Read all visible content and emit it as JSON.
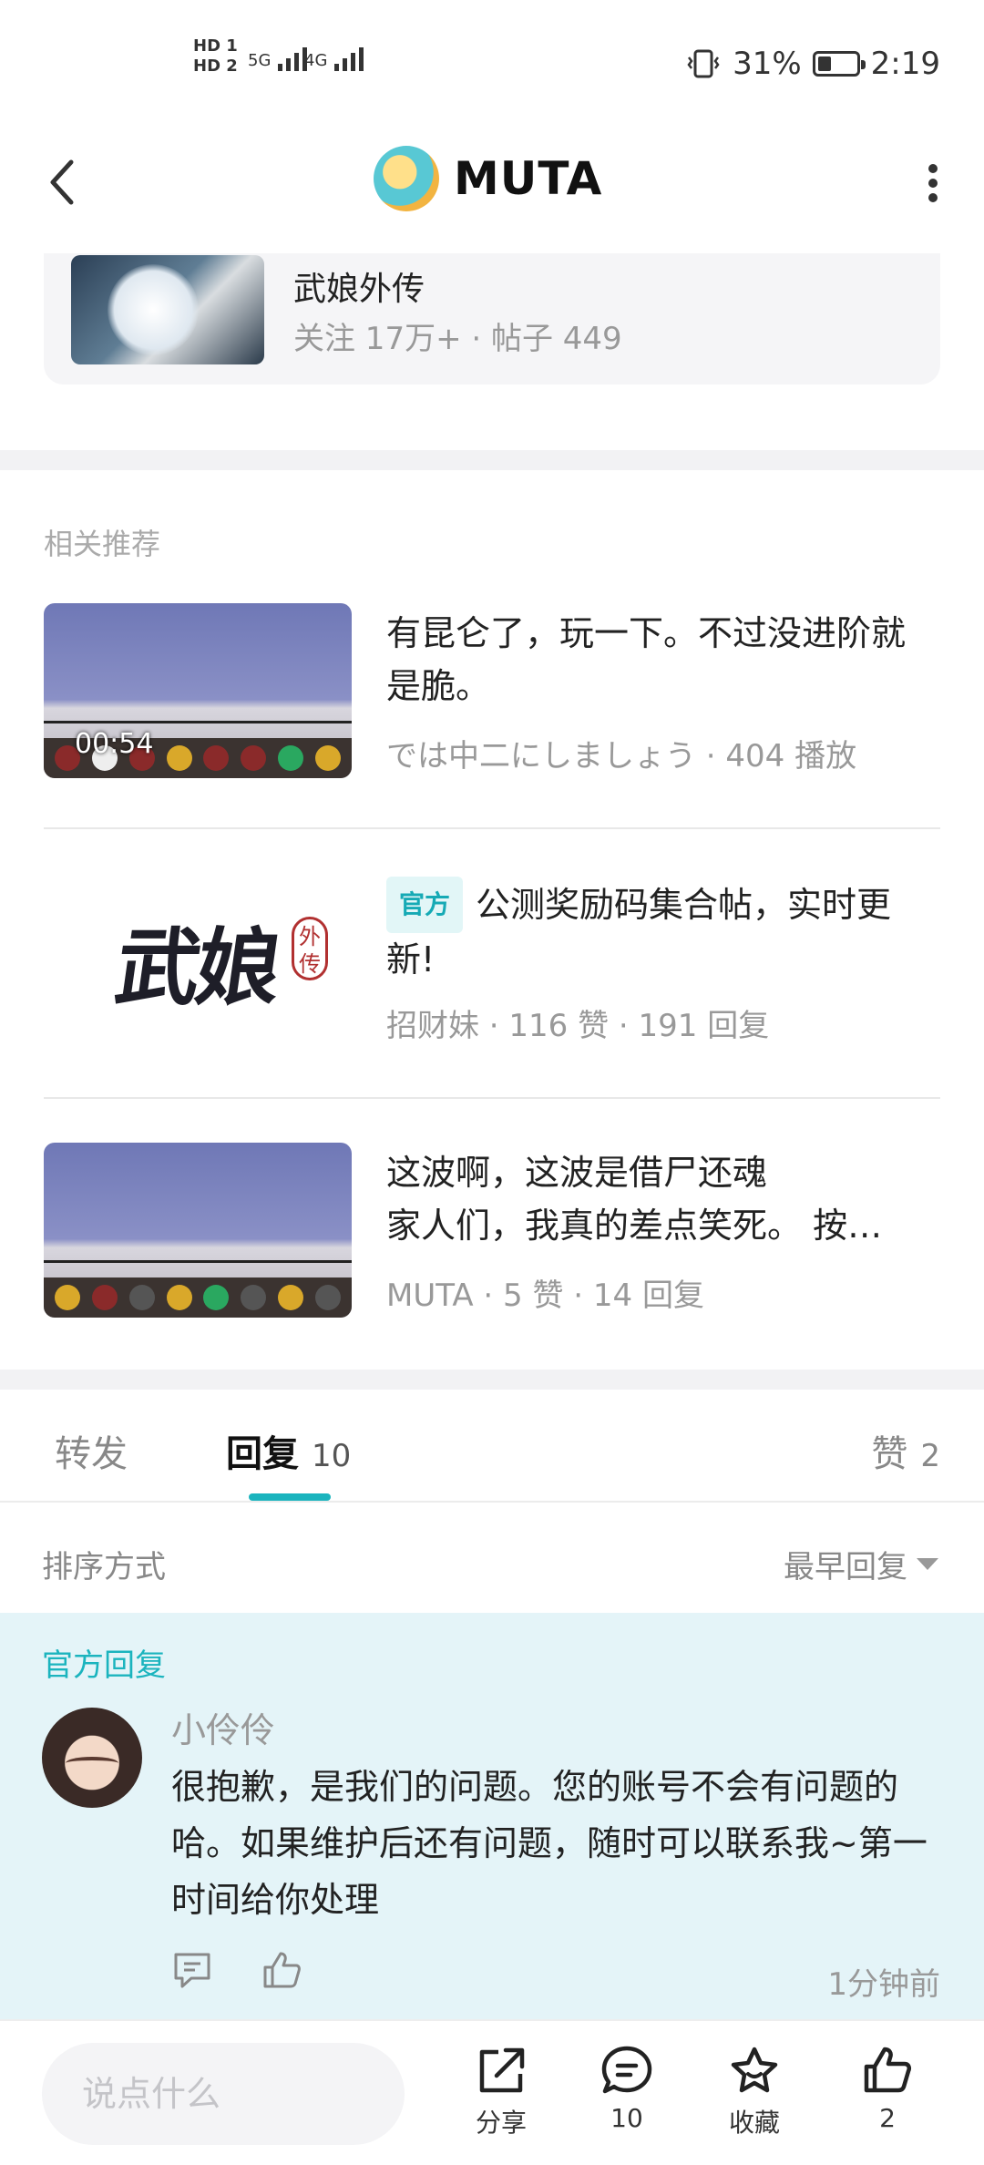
{
  "status_bar": {
    "hd1": "HD 1",
    "hd2": "HD 2",
    "net1": "5G",
    "net2": "4G",
    "battery_pct": "31%",
    "time": "2:19",
    "battery_level": 0.31
  },
  "header": {
    "app_name": "MUTA"
  },
  "forum": {
    "title": "武娘外传",
    "meta": "关注 17万+  ·  帖子 449"
  },
  "recommend": {
    "heading": "相关推荐",
    "items": [
      {
        "title": "有昆仑了，玩一下。不过没进阶就是脆。",
        "duration": "00:54",
        "meta": "では中二にしましょう · 404 播放"
      },
      {
        "tag": "官方",
        "title": "公测奖励码集合帖，实时更新!",
        "logo_main": "武娘",
        "logo_sub": "外传",
        "meta": "招财妹 · 116 赞 · 191 回复"
      },
      {
        "title": "这波啊，这波是借尸还魂\n家人们，我真的差点笑死。 按…",
        "meta": "MUTA · 5 赞 · 14 回复"
      }
    ]
  },
  "tabs": {
    "forward": "转发",
    "reply": "回复",
    "reply_count": "10",
    "like": "赞",
    "like_count": "2"
  },
  "sort": {
    "label": "排序方式",
    "value": "最早回复"
  },
  "official_reply": {
    "heading": "官方回复",
    "user": "小伶伶",
    "text": "很抱歉，是我们的问题。您的账号不会有问题的哈。如果维护后还有问题，随时可以联系我~第一时间给你处理",
    "time": "1分钟前"
  },
  "bottom_bar": {
    "input_placeholder": "说点什么",
    "share": "分享",
    "comments": "10",
    "favorite": "收藏",
    "likes": "2"
  },
  "colors": {
    "accent": "#1bb4be",
    "reply_bg": "#e4f4f8"
  }
}
